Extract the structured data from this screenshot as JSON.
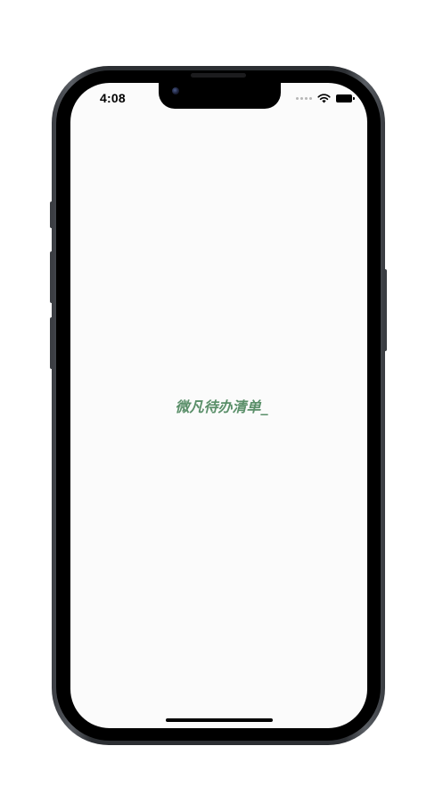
{
  "status_bar": {
    "time": "4:08",
    "signal_icon": "cellular-signal-dots",
    "wifi_icon": "wifi-icon",
    "battery_icon": "battery-full-icon"
  },
  "main": {
    "title": "微凡待办清单_"
  },
  "colors": {
    "title_color": "#5a8f69",
    "screen_background": "#fbfbfb",
    "frame_color": "#2c2f33"
  }
}
